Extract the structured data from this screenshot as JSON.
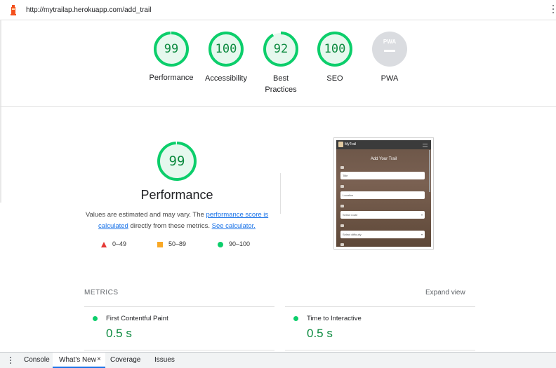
{
  "browser": {
    "url": "http://mytrailap.herokuapp.com/add_trail"
  },
  "scores": [
    {
      "label": "Performance",
      "value": "99",
      "fraction": 0.99
    },
    {
      "label": "Accessibility",
      "value": "100",
      "fraction": 1.0
    },
    {
      "label": "Best\nPractices",
      "value": "92",
      "fraction": 0.92
    },
    {
      "label": "SEO",
      "value": "100",
      "fraction": 1.0
    },
    {
      "label": "PWA",
      "value": "PWA",
      "fraction": 0
    }
  ],
  "performance": {
    "score": "99",
    "title": "Performance",
    "desc_1": "Values are estimated and may vary. The ",
    "link_1": "performance score is calculated",
    "desc_2": " directly from these metrics. ",
    "link_2": "See calculator."
  },
  "legend": {
    "fail": "0–49",
    "average": "50–89",
    "pass": "90–100"
  },
  "screenshot": {
    "brand": "MyTrail",
    "heading": "Add Your Trail",
    "fields": [
      "Title",
      "Location",
      "Select route",
      "Select difficulty"
    ]
  },
  "metrics": {
    "header": "METRICS",
    "expand": "Expand view",
    "items": [
      {
        "name": "First Contentful Paint",
        "value": "0.5 s"
      },
      {
        "name": "Time to Interactive",
        "value": "0.5 s"
      }
    ]
  },
  "drawer": {
    "tabs": [
      "Console",
      "What's New",
      "Coverage",
      "Issues"
    ],
    "active": "What's New",
    "close": "×"
  },
  "colors": {
    "pass": "#0cce6b",
    "pass_text": "#0c8a3f",
    "average": "#f9a825",
    "fail": "#e53935",
    "link": "#1a73e8"
  }
}
